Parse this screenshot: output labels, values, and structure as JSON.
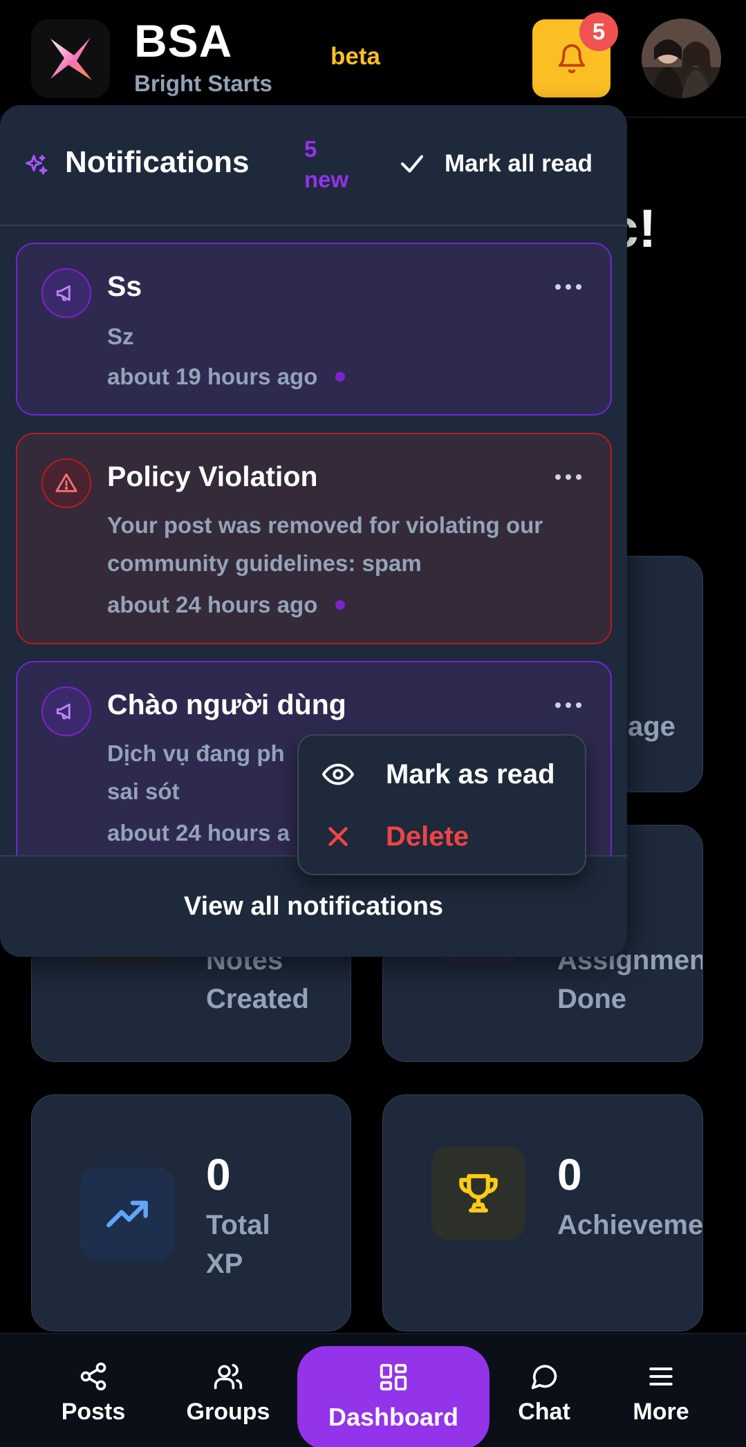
{
  "header": {
    "brand_name": "BSA",
    "brand_subtitle": "Bright Starts",
    "beta_label": "beta",
    "notification_count": "5",
    "accent_color": "#fbbf24"
  },
  "dashboard": {
    "greeting_partial": "c!",
    "cards": {
      "top_right_label": "age",
      "notes_label": [
        "Notes",
        "Created"
      ],
      "assignments_label": [
        "Assignments",
        "Done"
      ],
      "xp_value": "0",
      "xp_label": [
        "Total",
        "XP"
      ],
      "achievements_value": "0",
      "achievements_label": "Achievements"
    }
  },
  "notifications": {
    "title": "Notifications",
    "new_count": "5",
    "new_label": "new",
    "mark_all_label": "Mark all read",
    "items": [
      {
        "title": "Ss",
        "body": "Sz",
        "time": "about 19 hours ago",
        "variant": "announcement",
        "icon": "megaphone-icon"
      },
      {
        "title": "Policy Violation",
        "body": "Your post was removed for violating our community guidelines: spam",
        "time": "about 24 hours ago",
        "variant": "warning",
        "icon": "warning-triangle-icon"
      },
      {
        "title": "Chào người dùng",
        "body": "Dịch vụ đang ph",
        "body_line2": "sai sót",
        "time": "about 24 hours a",
        "variant": "announcement",
        "icon": "megaphone-icon"
      }
    ],
    "view_all_label": "View all notifications"
  },
  "context_menu": {
    "mark_read_label": "Mark as read",
    "delete_label": "Delete",
    "delete_color": "#ef4444"
  },
  "bottom_nav": {
    "items": [
      {
        "label": "Posts",
        "icon": "share-icon"
      },
      {
        "label": "Groups",
        "icon": "users-icon"
      },
      {
        "label": "Dashboard",
        "icon": "grid-icon",
        "active": true
      },
      {
        "label": "Chat",
        "icon": "chat-bubble-icon"
      },
      {
        "label": "More",
        "icon": "menu-icon"
      }
    ],
    "active_color": "#9333ea"
  }
}
